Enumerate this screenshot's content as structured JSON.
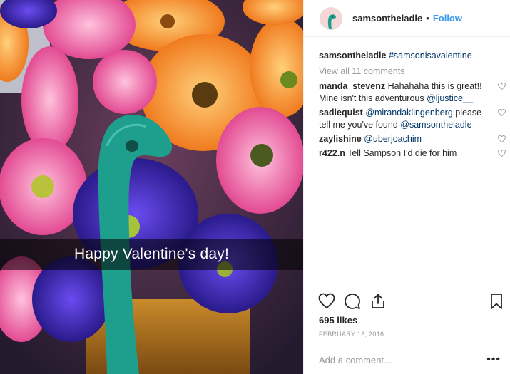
{
  "post": {
    "caption_overlay": "Happy Valentine's day!",
    "image_icon": "flowers-photo"
  },
  "header": {
    "username": "samsontheladle",
    "separator": "•",
    "follow_label": "Follow",
    "avatar_icon": "ladle-avatar-icon"
  },
  "caption": {
    "username": "samsontheladle",
    "hashtag": "#samsonisavalentine"
  },
  "view_all_label": "View all 11 comments",
  "comments": [
    {
      "user": "manda_stevenz",
      "text": "Hahahaha this is great!! Mine isn't this adventurous",
      "mention": "@ljustice__"
    },
    {
      "user": "sadiequist",
      "mention": "@mirandaklingenberg",
      "text": "please tell me you've found",
      "mention2": "@samsontheladle"
    },
    {
      "user": "zaylishine",
      "mention": "@uberjoachim"
    },
    {
      "user": "r422.n",
      "text": "Tell Sampson I'd die for him"
    }
  ],
  "actions": {
    "like_icon": "heart-icon",
    "comment_icon": "comment-icon",
    "share_icon": "share-icon",
    "save_icon": "bookmark-icon"
  },
  "likes_label": "695 likes",
  "date_label": "FEBRUARY 13, 2016",
  "add_comment_placeholder": "Add a comment...",
  "more_label": "•••",
  "colors": {
    "link": "#003569",
    "follow": "#3897f0",
    "muted": "#999999",
    "ladle": "#1e9e8c"
  }
}
